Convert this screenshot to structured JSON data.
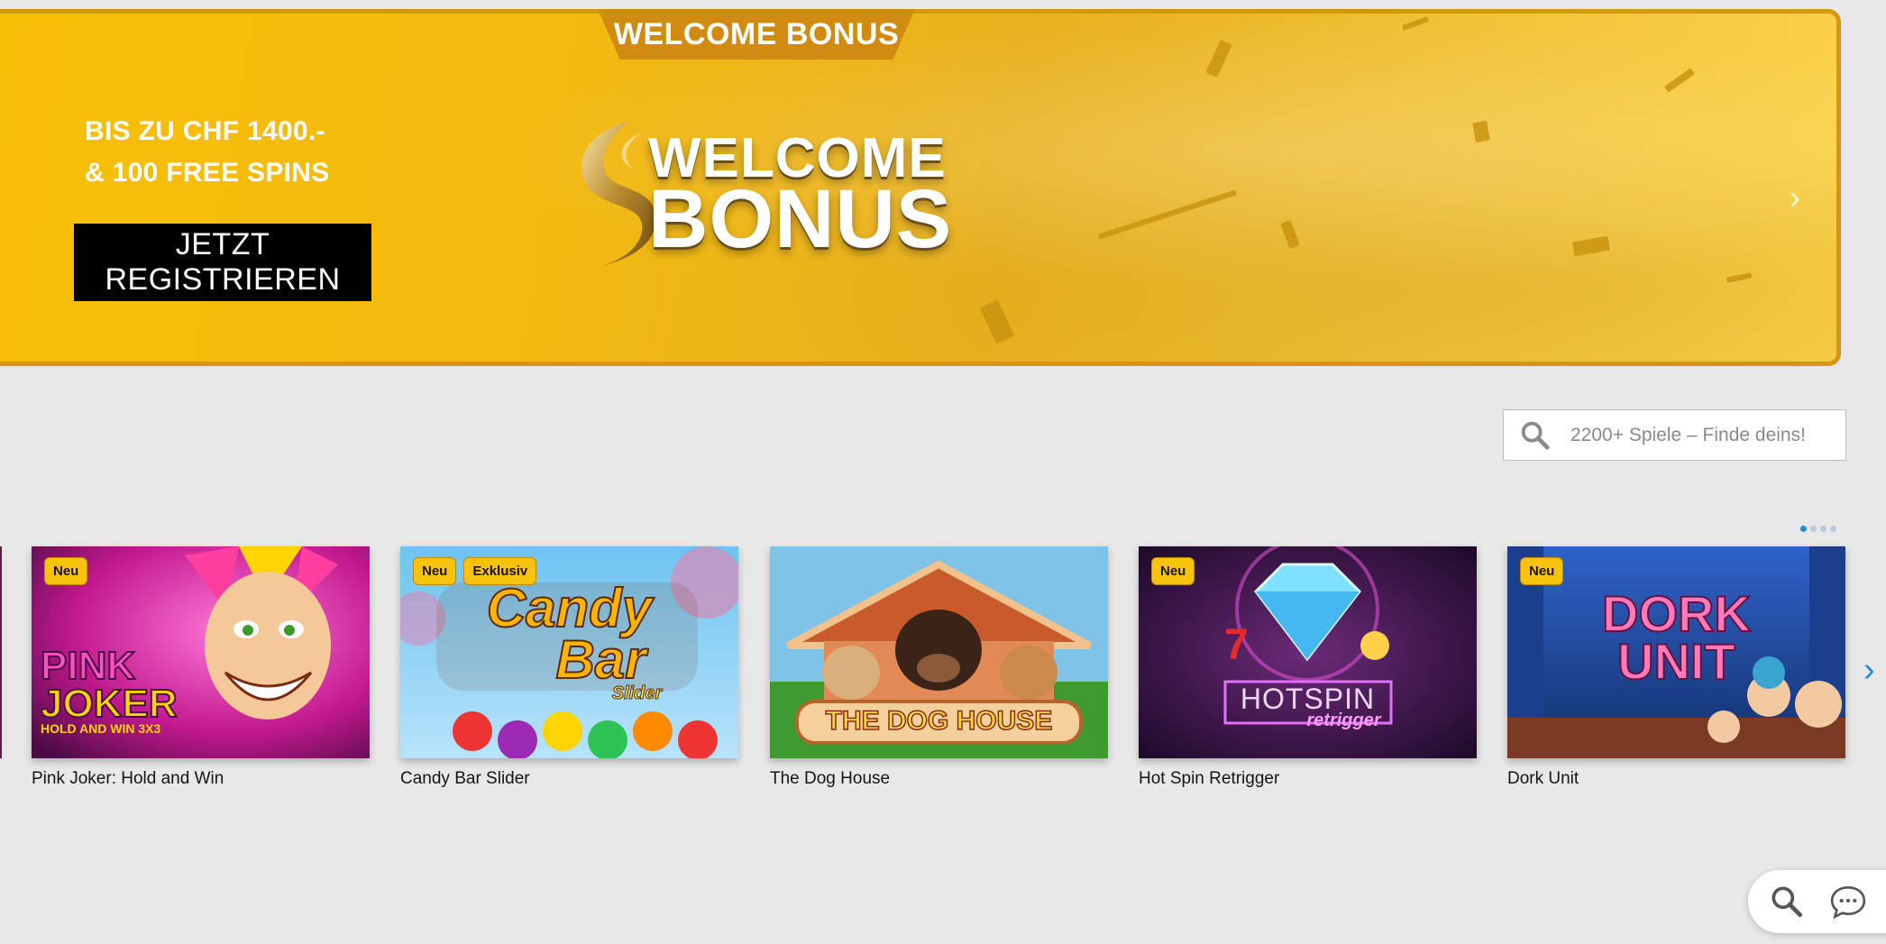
{
  "hero": {
    "tab_label": "WELCOME BONUS",
    "line1": "BIS ZU CHF 1400.-",
    "line2": "& 100 FREE SPINS",
    "cta_label": "JETZT REGISTRIEREN",
    "logo_line1": "WELCOME",
    "logo_line2": "BONUS",
    "next_icon": "chevron-right-icon"
  },
  "search": {
    "placeholder": "2200+ Spiele – Finde deins!",
    "icon": "search-icon"
  },
  "pager": {
    "total": 4,
    "active": 1
  },
  "games": [
    {
      "title": "Pink Joker: Hold and Win",
      "badges": [
        "Neu"
      ],
      "art_line1": "PINK",
      "art_line2": "JOKER",
      "art_line3": "HOLD AND WIN 3X3"
    },
    {
      "title": "Candy Bar Slider",
      "badges": [
        "Neu",
        "Exklusiv"
      ],
      "art_line1": "Candy",
      "art_line2": "Bar",
      "art_line3": "Slider"
    },
    {
      "title": "The Dog House",
      "badges": [],
      "art_line1": "THE DOG HOUSE"
    },
    {
      "title": "Hot Spin Retrigger",
      "badges": [
        "Neu"
      ],
      "art_line1": "HOTSPIN",
      "art_line2": "retrigger"
    },
    {
      "title": "Dork Unit",
      "badges": [
        "Neu"
      ],
      "art_line1": "DORK",
      "art_line2": "UNIT"
    }
  ],
  "colors": {
    "accent_gold": "#f3ba10",
    "banner_border": "#d59612",
    "badge_yellow": "#f8c30c",
    "link_blue": "#1a8fd6"
  },
  "widget": {
    "search_icon": "search-icon",
    "chat_icon": "chat-bubble-icon"
  }
}
